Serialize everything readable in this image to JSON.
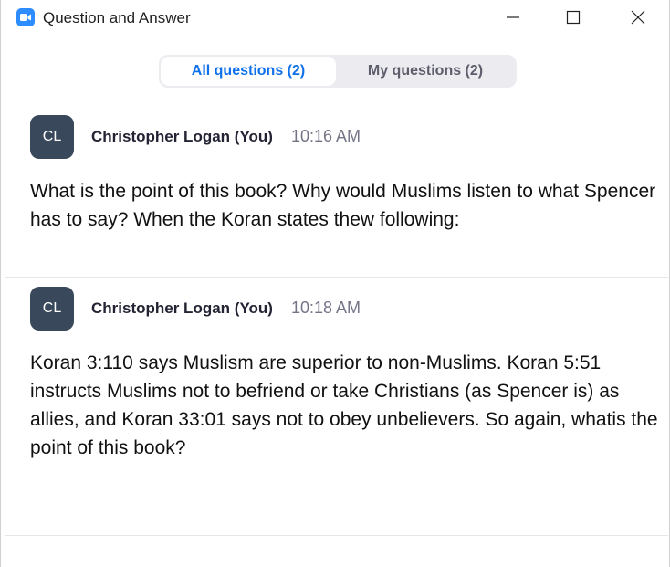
{
  "window": {
    "title": "Question and Answer",
    "icon": "zoom-camera-icon",
    "controls": [
      "minimize-icon",
      "maximize-icon",
      "close-icon"
    ]
  },
  "tabs": [
    {
      "label": "All questions (2)",
      "selected": true
    },
    {
      "label": "My questions (2)",
      "selected": false
    }
  ],
  "questions": [
    {
      "avatar": "CL",
      "author": "Christopher Logan (You)",
      "time": "10:16 AM",
      "text": "What is the point of this book? Why would Muslims listen to what Spencer has to say? When the Koran states thew following:"
    },
    {
      "avatar": "CL",
      "author": "Christopher Logan (You)",
      "time": "10:18 AM",
      "text": "Koran 3:110 says Muslism are superior to non-Muslims. Koran 5:51 instructs Muslims not to befriend or take Christians (as Spencer is) as allies, and Koran 33:01 says not to obey unbelievers. So again, whatis the point of this book?"
    }
  ],
  "colors": {
    "accent": "#0e71eb",
    "zoom_blue": "#2d8cff",
    "avatar_bg": "#39485a",
    "tab_bg": "#ebebf0",
    "muted_text": "#747487"
  }
}
